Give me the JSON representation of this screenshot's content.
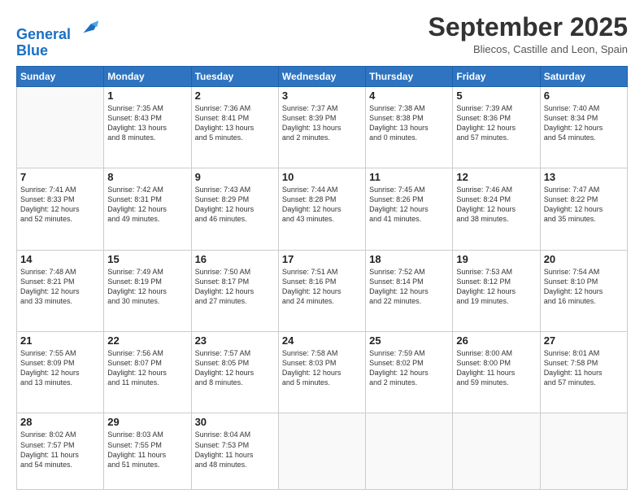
{
  "header": {
    "logo_line1": "General",
    "logo_line2": "Blue",
    "title": "September 2025",
    "subtitle": "Bliecos, Castille and Leon, Spain"
  },
  "days_of_week": [
    "Sunday",
    "Monday",
    "Tuesday",
    "Wednesday",
    "Thursday",
    "Friday",
    "Saturday"
  ],
  "weeks": [
    [
      {
        "day": "",
        "info": ""
      },
      {
        "day": "1",
        "info": "Sunrise: 7:35 AM\nSunset: 8:43 PM\nDaylight: 13 hours\nand 8 minutes."
      },
      {
        "day": "2",
        "info": "Sunrise: 7:36 AM\nSunset: 8:41 PM\nDaylight: 13 hours\nand 5 minutes."
      },
      {
        "day": "3",
        "info": "Sunrise: 7:37 AM\nSunset: 8:39 PM\nDaylight: 13 hours\nand 2 minutes."
      },
      {
        "day": "4",
        "info": "Sunrise: 7:38 AM\nSunset: 8:38 PM\nDaylight: 13 hours\nand 0 minutes."
      },
      {
        "day": "5",
        "info": "Sunrise: 7:39 AM\nSunset: 8:36 PM\nDaylight: 12 hours\nand 57 minutes."
      },
      {
        "day": "6",
        "info": "Sunrise: 7:40 AM\nSunset: 8:34 PM\nDaylight: 12 hours\nand 54 minutes."
      }
    ],
    [
      {
        "day": "7",
        "info": "Sunrise: 7:41 AM\nSunset: 8:33 PM\nDaylight: 12 hours\nand 52 minutes."
      },
      {
        "day": "8",
        "info": "Sunrise: 7:42 AM\nSunset: 8:31 PM\nDaylight: 12 hours\nand 49 minutes."
      },
      {
        "day": "9",
        "info": "Sunrise: 7:43 AM\nSunset: 8:29 PM\nDaylight: 12 hours\nand 46 minutes."
      },
      {
        "day": "10",
        "info": "Sunrise: 7:44 AM\nSunset: 8:28 PM\nDaylight: 12 hours\nand 43 minutes."
      },
      {
        "day": "11",
        "info": "Sunrise: 7:45 AM\nSunset: 8:26 PM\nDaylight: 12 hours\nand 41 minutes."
      },
      {
        "day": "12",
        "info": "Sunrise: 7:46 AM\nSunset: 8:24 PM\nDaylight: 12 hours\nand 38 minutes."
      },
      {
        "day": "13",
        "info": "Sunrise: 7:47 AM\nSunset: 8:22 PM\nDaylight: 12 hours\nand 35 minutes."
      }
    ],
    [
      {
        "day": "14",
        "info": "Sunrise: 7:48 AM\nSunset: 8:21 PM\nDaylight: 12 hours\nand 33 minutes."
      },
      {
        "day": "15",
        "info": "Sunrise: 7:49 AM\nSunset: 8:19 PM\nDaylight: 12 hours\nand 30 minutes."
      },
      {
        "day": "16",
        "info": "Sunrise: 7:50 AM\nSunset: 8:17 PM\nDaylight: 12 hours\nand 27 minutes."
      },
      {
        "day": "17",
        "info": "Sunrise: 7:51 AM\nSunset: 8:16 PM\nDaylight: 12 hours\nand 24 minutes."
      },
      {
        "day": "18",
        "info": "Sunrise: 7:52 AM\nSunset: 8:14 PM\nDaylight: 12 hours\nand 22 minutes."
      },
      {
        "day": "19",
        "info": "Sunrise: 7:53 AM\nSunset: 8:12 PM\nDaylight: 12 hours\nand 19 minutes."
      },
      {
        "day": "20",
        "info": "Sunrise: 7:54 AM\nSunset: 8:10 PM\nDaylight: 12 hours\nand 16 minutes."
      }
    ],
    [
      {
        "day": "21",
        "info": "Sunrise: 7:55 AM\nSunset: 8:09 PM\nDaylight: 12 hours\nand 13 minutes."
      },
      {
        "day": "22",
        "info": "Sunrise: 7:56 AM\nSunset: 8:07 PM\nDaylight: 12 hours\nand 11 minutes."
      },
      {
        "day": "23",
        "info": "Sunrise: 7:57 AM\nSunset: 8:05 PM\nDaylight: 12 hours\nand 8 minutes."
      },
      {
        "day": "24",
        "info": "Sunrise: 7:58 AM\nSunset: 8:03 PM\nDaylight: 12 hours\nand 5 minutes."
      },
      {
        "day": "25",
        "info": "Sunrise: 7:59 AM\nSunset: 8:02 PM\nDaylight: 12 hours\nand 2 minutes."
      },
      {
        "day": "26",
        "info": "Sunrise: 8:00 AM\nSunset: 8:00 PM\nDaylight: 11 hours\nand 59 minutes."
      },
      {
        "day": "27",
        "info": "Sunrise: 8:01 AM\nSunset: 7:58 PM\nDaylight: 11 hours\nand 57 minutes."
      }
    ],
    [
      {
        "day": "28",
        "info": "Sunrise: 8:02 AM\nSunset: 7:57 PM\nDaylight: 11 hours\nand 54 minutes."
      },
      {
        "day": "29",
        "info": "Sunrise: 8:03 AM\nSunset: 7:55 PM\nDaylight: 11 hours\nand 51 minutes."
      },
      {
        "day": "30",
        "info": "Sunrise: 8:04 AM\nSunset: 7:53 PM\nDaylight: 11 hours\nand 48 minutes."
      },
      {
        "day": "",
        "info": ""
      },
      {
        "day": "",
        "info": ""
      },
      {
        "day": "",
        "info": ""
      },
      {
        "day": "",
        "info": ""
      }
    ]
  ]
}
